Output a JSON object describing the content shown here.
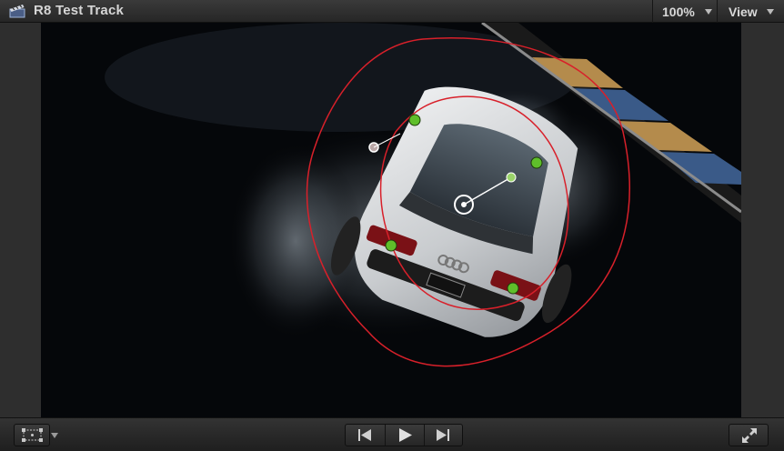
{
  "window": {
    "title": "R8 Test Track",
    "zoom_label": "100%",
    "view_label": "View"
  },
  "toolbar": {
    "transform_tool_icon": "transform-icon",
    "previous_icon": "skip-back-icon",
    "play_icon": "play-icon",
    "next_icon": "skip-forward-icon",
    "fullscreen_icon": "fullscreen-icon"
  },
  "colors": {
    "shape_outline": "#d8202a",
    "control_point": "#5fbf2a",
    "background": "#2b2b2b"
  }
}
